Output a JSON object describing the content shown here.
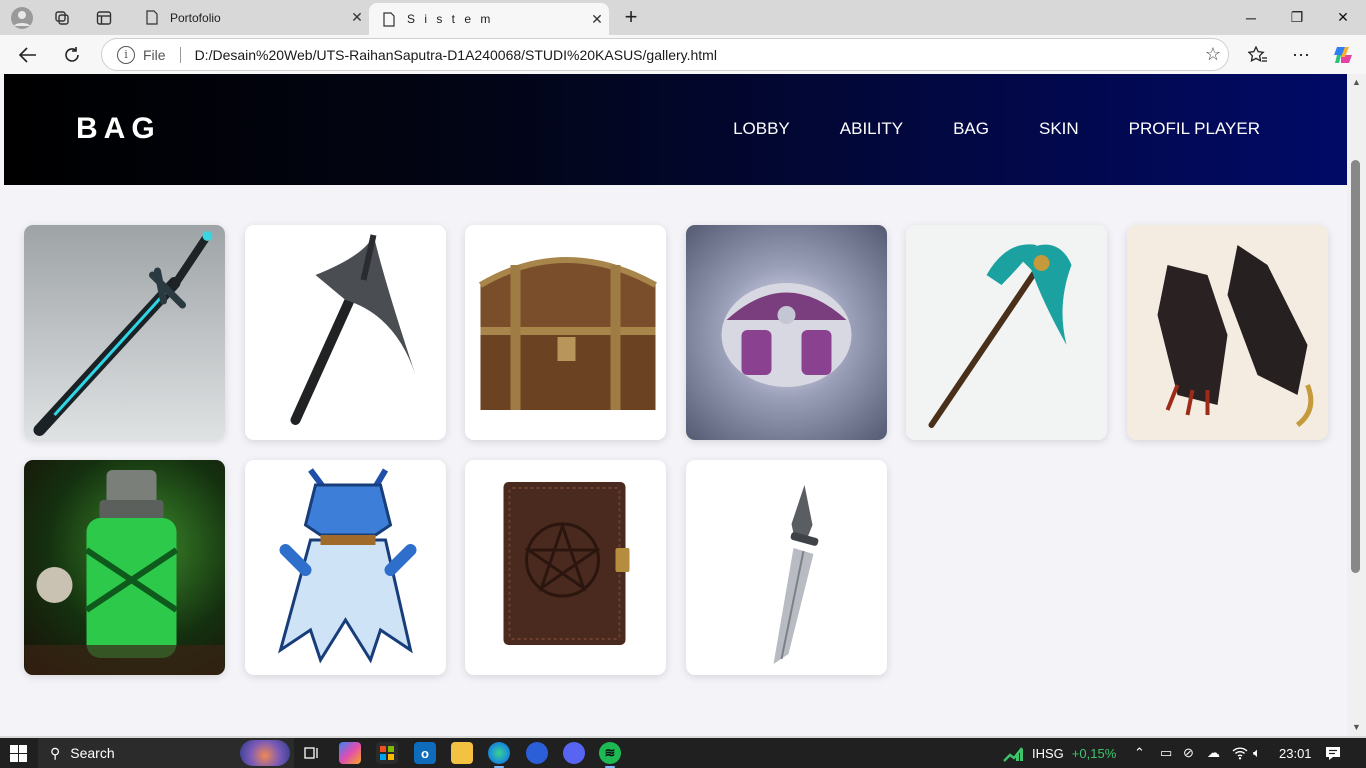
{
  "browser": {
    "tabs": [
      {
        "title": "Portofolio",
        "active": false
      },
      {
        "title": "S i s t e m",
        "active": true
      }
    ],
    "url_label": "File",
    "url": "D:/Desain%20Web/UTS-RaihanSaputra-D1A240068/STUDI%20KASUS/gallery.html"
  },
  "site": {
    "logo": "BAG",
    "menu": [
      "LOBBY",
      "ABILITY",
      "BAG",
      "SKIN",
      "PROFIL PLAYER"
    ]
  },
  "gallery": {
    "items": [
      {
        "icon": "sword-image"
      },
      {
        "icon": "pickaxe-image"
      },
      {
        "icon": "treasure-chest-image"
      },
      {
        "icon": "magic-bag-image"
      },
      {
        "icon": "jade-scythe-image"
      },
      {
        "icon": "claw-gauntlets-image"
      },
      {
        "icon": "green-potion-image"
      },
      {
        "icon": "ice-armor-image"
      },
      {
        "icon": "pentagram-book-image"
      },
      {
        "icon": "dagger-image"
      }
    ]
  },
  "taskbar": {
    "search_label": "Search",
    "stock_label": "IHSG",
    "stock_change": "+0,15%",
    "time": "23:01"
  },
  "colors": {
    "header_start": "#000000",
    "header_end": "#010a66",
    "page_bg": "#f3f3f8",
    "stock_up": "#3ec46d"
  }
}
